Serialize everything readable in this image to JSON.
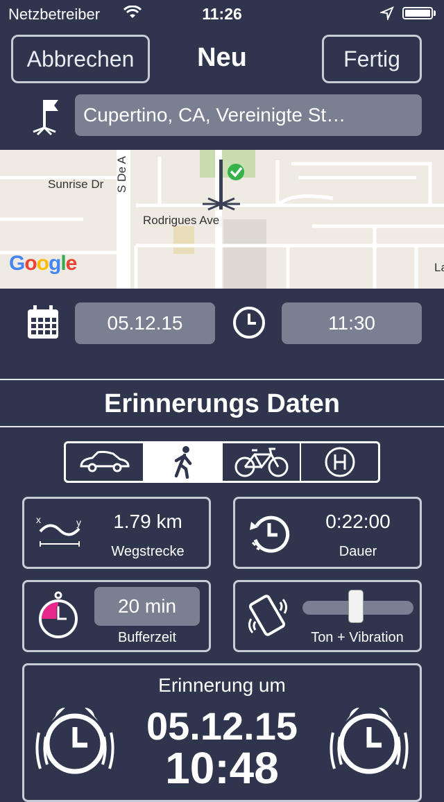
{
  "status_bar": {
    "carrier": "Netzbetreiber",
    "time": "11:26"
  },
  "nav": {
    "cancel_label": "Abbrechen",
    "title": "Neu",
    "done_label": "Fertig"
  },
  "location": {
    "value": "Cupertino, CA, Vereinigte St…",
    "icon": "flag-pin-icon"
  },
  "map": {
    "labels": {
      "street1": "Sunrise Dr",
      "street2": "Rodrigues Ave",
      "street3": "S De A",
      "street4": "La"
    },
    "provider": "Google"
  },
  "datetime": {
    "date": "05.12.15",
    "time": "11:30"
  },
  "section_title": "Erinnerungs Daten",
  "transport_modes": [
    {
      "name": "car",
      "active": false
    },
    {
      "name": "walk",
      "active": true
    },
    {
      "name": "bike",
      "active": false
    },
    {
      "name": "transit",
      "active": false
    }
  ],
  "distance": {
    "value": "1.79 km",
    "label": "Wegstrecke"
  },
  "duration": {
    "value": "0:22:00",
    "label": "Dauer"
  },
  "buffer": {
    "value": "20 min",
    "label": "Bufferzeit"
  },
  "alert": {
    "label": "Ton + Vibration",
    "level": 0.48
  },
  "reminder": {
    "label": "Erinnerung um",
    "date": "05.12.15",
    "time": "10:48"
  },
  "colors": {
    "background": "#2e354d",
    "pill": "#7a7f91",
    "accent_green": "#35b24a",
    "accent_pink": "#e8288a"
  }
}
